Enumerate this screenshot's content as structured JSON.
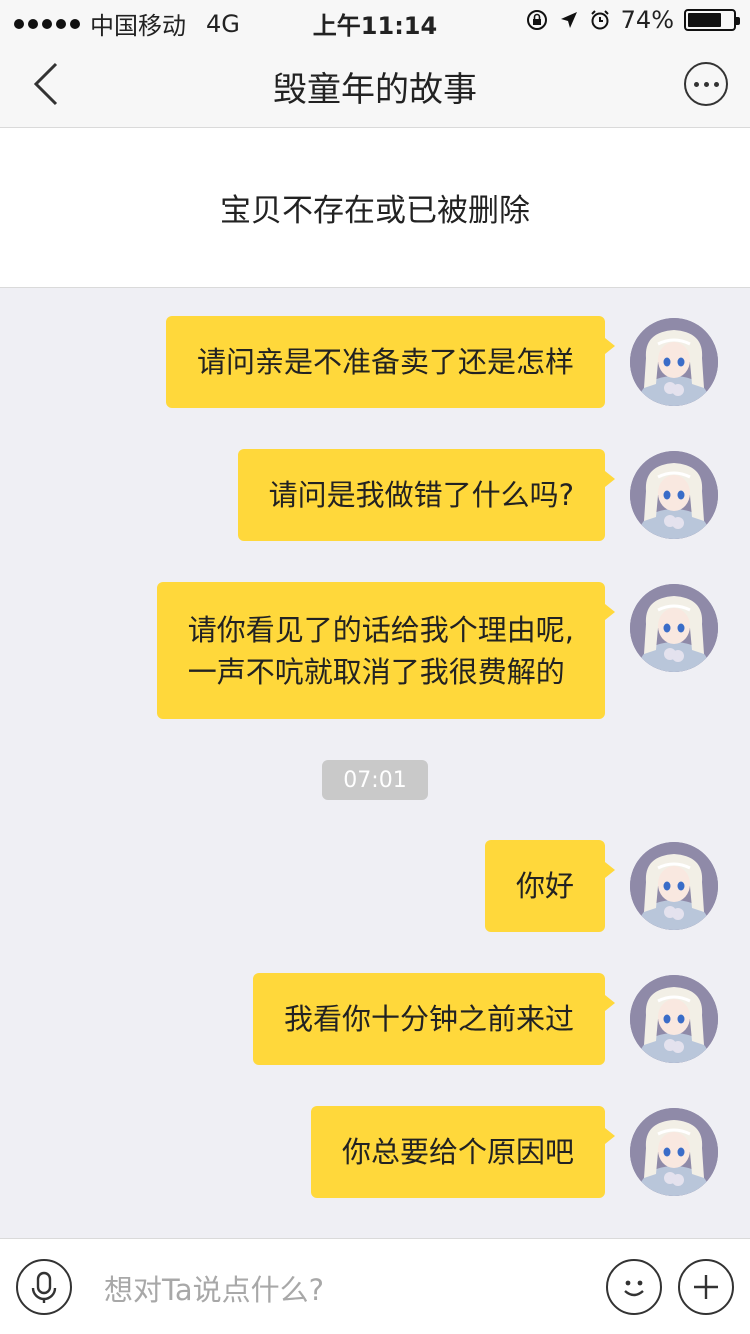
{
  "status_bar": {
    "carrier": "中国移动",
    "network": "4G",
    "time": "上午11:14",
    "battery_percent": "74%",
    "battery_level": 0.74
  },
  "nav": {
    "title": "毁童年的故事",
    "back_icon": "chevron-left-icon",
    "more_icon": "more-dots-icon"
  },
  "notice": {
    "text": "宝贝不存在或已被删除"
  },
  "messages": [
    {
      "lines": [
        "请问亲是不准备卖了还是怎样"
      ]
    },
    {
      "lines": [
        "请问是我做错了什么吗?"
      ]
    },
    {
      "lines": [
        "请你看见了的话给我个理由呢,",
        "一声不吭就取消了我很费解的"
      ]
    },
    {
      "lines": [
        "你好"
      ]
    },
    {
      "lines": [
        "我看你十分钟之前来过"
      ]
    },
    {
      "lines": [
        "你总要给个原因吧"
      ]
    }
  ],
  "timestamp": "07:01",
  "input_bar": {
    "placeholder": "想对Ta说点什么?",
    "mic_icon": "microphone-icon",
    "emoji_icon": "emoji-icon",
    "plus_icon": "plus-icon"
  },
  "colors": {
    "bubble": "#FFD83B",
    "background": "#EFEFF4",
    "timestamp_chip": "#C9C9C9"
  }
}
